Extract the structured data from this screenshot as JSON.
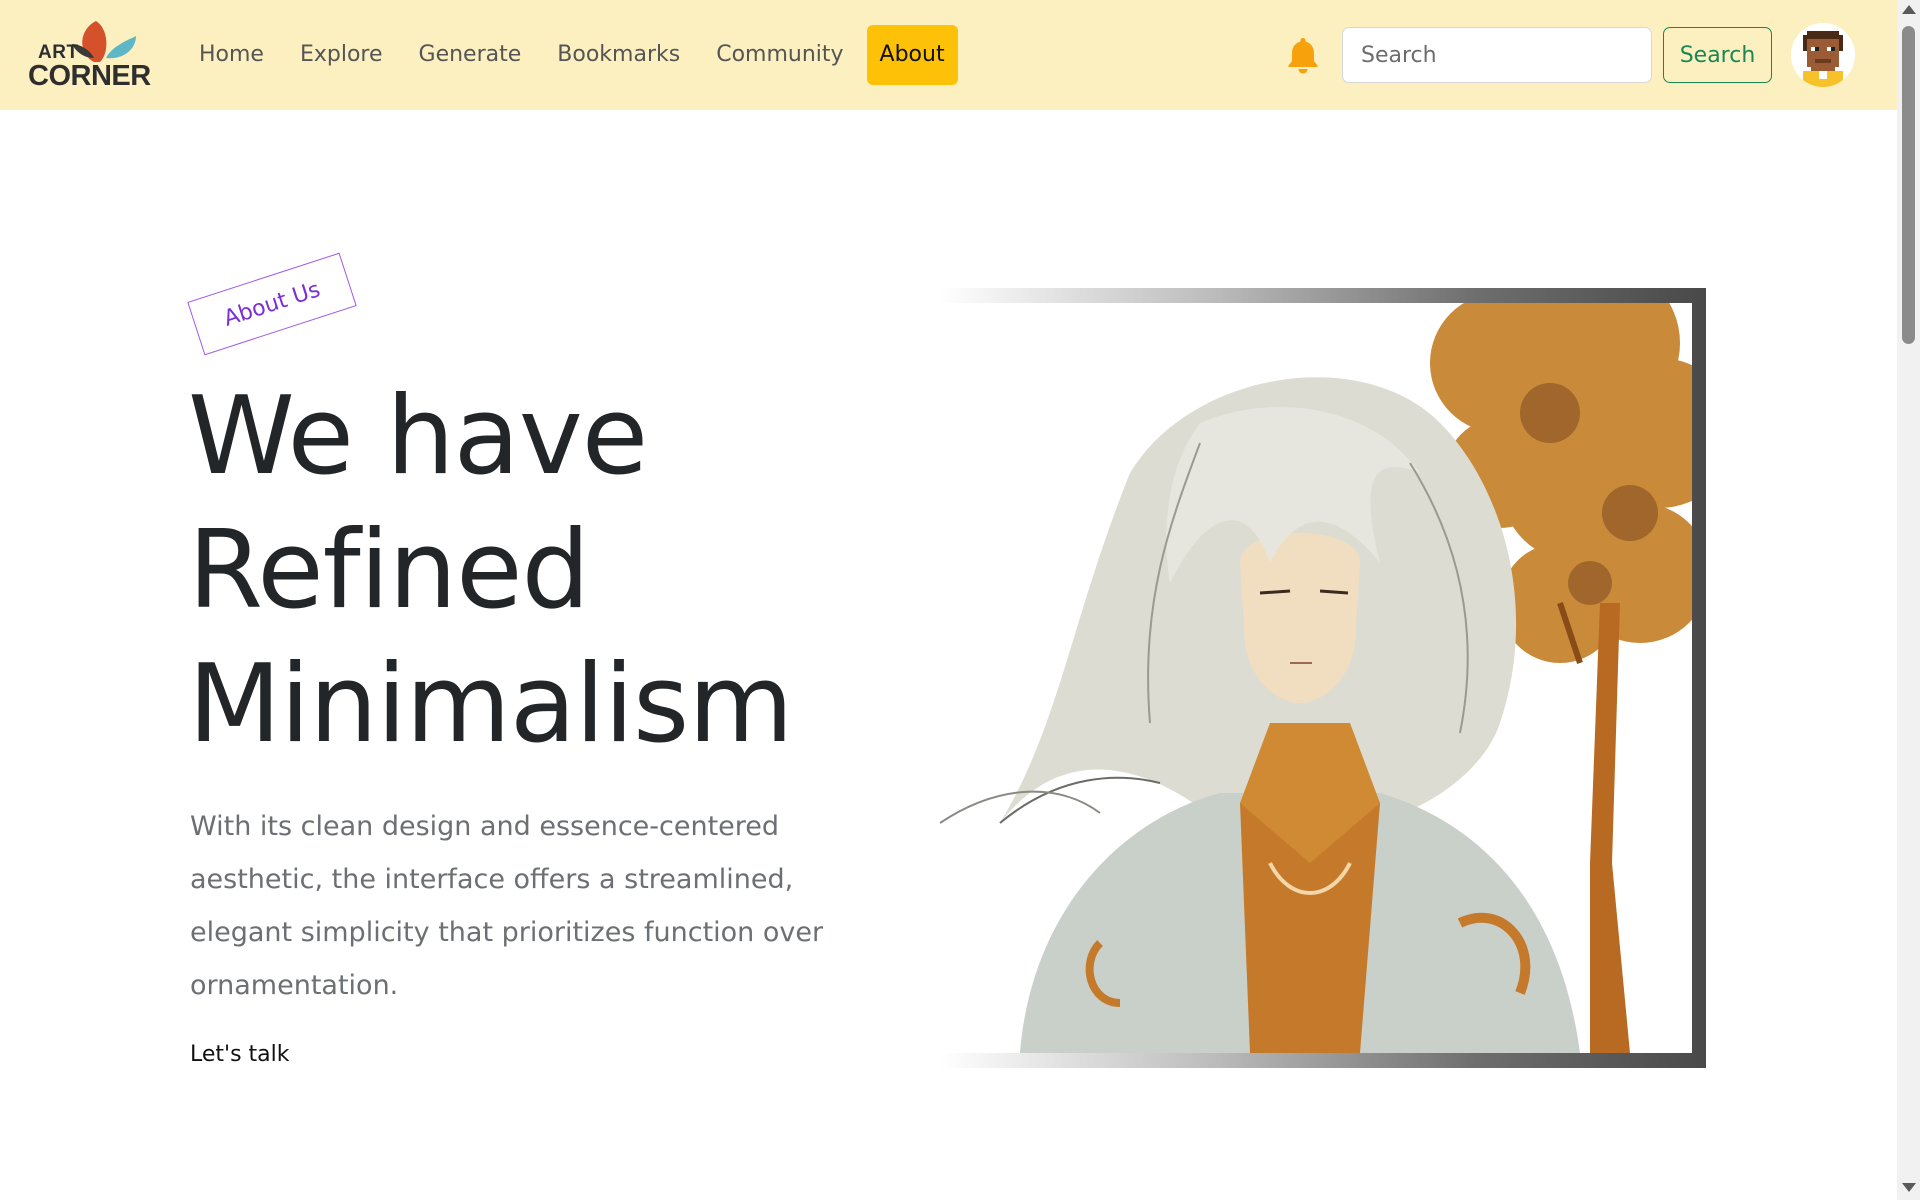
{
  "brand": {
    "line1": "ART",
    "line2": "CORNER",
    "colors": {
      "petal_red": "#d5512b",
      "petal_teal": "#5db7c7",
      "petal_dark": "#3a3a3a"
    }
  },
  "nav": {
    "items": [
      {
        "label": "Home",
        "active": false
      },
      {
        "label": "Explore",
        "active": false
      },
      {
        "label": "Generate",
        "active": false
      },
      {
        "label": "Bookmarks",
        "active": false
      },
      {
        "label": "Community",
        "active": false
      },
      {
        "label": "About",
        "active": true
      }
    ],
    "background": "#fcefc0",
    "active_color": "#fdc107"
  },
  "header_actions": {
    "notification_icon": "bell-icon",
    "search": {
      "placeholder": "Search",
      "value": ""
    },
    "search_button_label": "Search",
    "avatar_icon": "pixel-avatar-icon"
  },
  "hero": {
    "badge": "About Us",
    "title_lines": [
      "We have",
      "Refined",
      "Minimalism"
    ],
    "description": "With its clean design and essence-centered aesthetic, the interface offers a streamlined, elegant simplicity that prioritizes function over ornamentation.",
    "cta": "Let's talk",
    "image_icon": "anime-character-illustration"
  },
  "colors": {
    "title": "#222629",
    "body_text": "#6c6f73",
    "badge": "#7c2fd6",
    "search_button": "#198754"
  }
}
